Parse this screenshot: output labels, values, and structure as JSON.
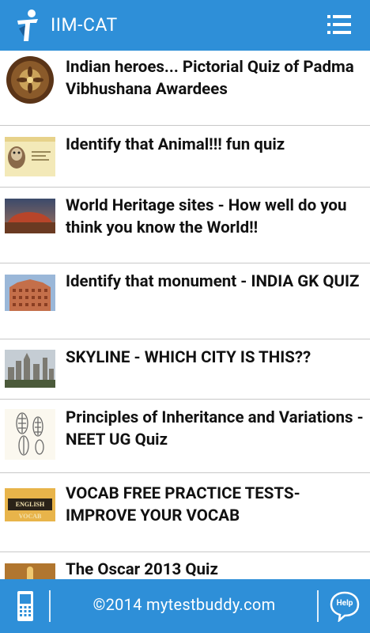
{
  "app": {
    "title": "IIM-CAT"
  },
  "quizzes": [
    {
      "title": "Indian heroes... Pictorial Quiz of Padma Vibhushana Awardees"
    },
    {
      "title": "Identify that Animal!!! fun quiz"
    },
    {
      "title": "World Heritage sites - How well do you think you know the World!!"
    },
    {
      "title": "Identify that monument - INDIA GK QUIZ"
    },
    {
      "title": "SKYLINE - WHICH CITY IS THIS??"
    },
    {
      "title": "Principles of Inheritance and Variations - NEET UG Quiz"
    },
    {
      "title": "VOCAB FREE PRACTICE TESTS- IMPROVE YOUR VOCAB"
    },
    {
      "title": "The Oscar 2013 Quiz"
    }
  ],
  "thumb_text": {
    "vocab": "ENGLISH VOCAB"
  },
  "footer": {
    "copyright": "©2014 mytestbuddy.com",
    "help_label": "Help"
  },
  "colors": {
    "accent": "#2e8fd8",
    "divider": "#c8c8c8"
  }
}
